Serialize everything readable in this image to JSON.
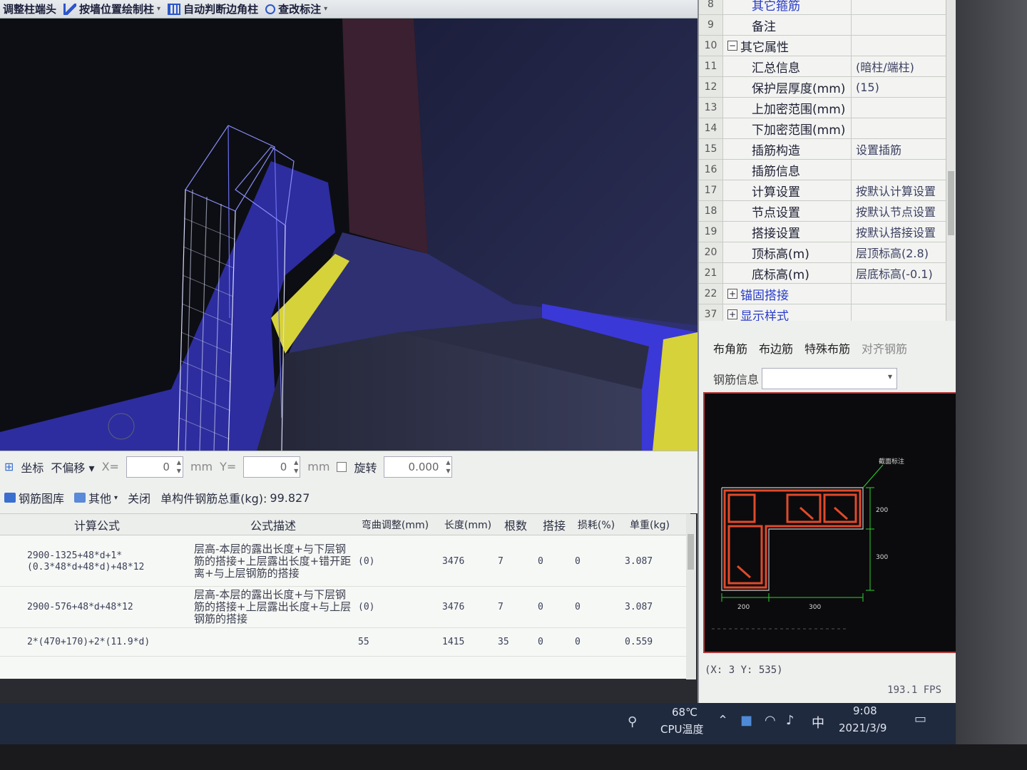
{
  "toolbar": {
    "items": [
      {
        "label": "调整柱端头"
      },
      {
        "label": "按墙位置绘制柱"
      },
      {
        "label": "自动判断边角柱"
      },
      {
        "label": "查改标注"
      }
    ]
  },
  "properties": {
    "rows": [
      {
        "num": "8",
        "name": "其它箍筋",
        "value": ""
      },
      {
        "num": "9",
        "name": "备注",
        "value": ""
      },
      {
        "num": "10",
        "name": "其它属性",
        "value": "",
        "expander": "−"
      },
      {
        "num": "11",
        "name": "汇总信息",
        "value": "(暗柱/端柱)"
      },
      {
        "num": "12",
        "name": "保护层厚度(mm)",
        "value": "(15)"
      },
      {
        "num": "13",
        "name": "上加密范围(mm)",
        "value": ""
      },
      {
        "num": "14",
        "name": "下加密范围(mm)",
        "value": ""
      },
      {
        "num": "15",
        "name": "插筋构造",
        "value": "设置插筋"
      },
      {
        "num": "16",
        "name": "插筋信息",
        "value": ""
      },
      {
        "num": "17",
        "name": "计算设置",
        "value": "按默认计算设置"
      },
      {
        "num": "18",
        "name": "节点设置",
        "value": "按默认节点设置"
      },
      {
        "num": "19",
        "name": "搭接设置",
        "value": "按默认搭接设置"
      },
      {
        "num": "20",
        "name": "顶标高(m)",
        "value": "层顶标高(2.8)"
      },
      {
        "num": "21",
        "name": "底标高(m)",
        "value": "层底标高(-0.1)"
      },
      {
        "num": "22",
        "name": "锚固搭接",
        "value": "",
        "expander": "+"
      },
      {
        "num": "37",
        "name": "显示样式",
        "value": "",
        "expander": "+"
      }
    ]
  },
  "rebar_panel": {
    "tabs": [
      "布角筋",
      "布边筋",
      "特殊布筋",
      "对齐钢筋"
    ],
    "info_label": "钢筋信息",
    "info_value": "",
    "section_label": "截面标注",
    "dims": {
      "top_right": "200",
      "mid_right": "300",
      "bottom_left": "200",
      "bottom_mid": "300"
    },
    "coord_text": "(X: 3 Y: 535)",
    "fps_text": "193.1 FPS"
  },
  "coordbar": {
    "label": "坐标",
    "offset": "不偏移",
    "x_label": "X=",
    "x_value": "0",
    "unit1": "mm",
    "y_label": "Y=",
    "y_value": "0",
    "unit2": "mm",
    "rotate_label": "旋转",
    "rotate_value": "0.000"
  },
  "tbl_toolbar": {
    "library": "钢筋图库",
    "other": "其他",
    "close": "关闭",
    "total_label": "单构件钢筋总重(kg):",
    "total_value": "99.827"
  },
  "rebar_table": {
    "headers": [
      "计算公式",
      "公式描述",
      "弯曲调整(mm)",
      "长度(mm)",
      "根数",
      "搭接",
      "损耗(%)",
      "单重(kg)"
    ],
    "rows": [
      {
        "formula": "2900-1325+48*d+1*(0.3*48*d+48*d)+48*12",
        "desc": "层高-本层的露出长度+与下层钢筋的搭接+上层露出长度+错开距离+与上层钢筋的搭接",
        "bend": "(0)",
        "length": "3476",
        "count": "7",
        "lap": "0",
        "loss": "0",
        "weight": "3.087"
      },
      {
        "formula": "2900-576+48*d+48*12",
        "desc": "层高-本层的露出长度+与下层钢筋的搭接+上层露出长度+与上层钢筋的搭接",
        "bend": "(0)",
        "length": "3476",
        "count": "7",
        "lap": "0",
        "loss": "0",
        "weight": "3.087"
      },
      {
        "formula": "2*(470+170)+2*(11.9*d)",
        "desc": "",
        "bend": "55",
        "length": "1415",
        "count": "35",
        "lap": "0",
        "loss": "0",
        "weight": "0.559"
      }
    ]
  },
  "taskbar": {
    "cpu_temp": "68℃",
    "cpu_label": "CPU温度",
    "ime": "中",
    "time": "9:08",
    "date": "2021/3/9"
  },
  "colors": {
    "viewport_bg": "#0d0e13",
    "wall_blue": "#3b38d8",
    "slab_yellow": "#d6d23a",
    "rebar_red": "#e04a2a",
    "dim_green": "#2ed12e"
  }
}
